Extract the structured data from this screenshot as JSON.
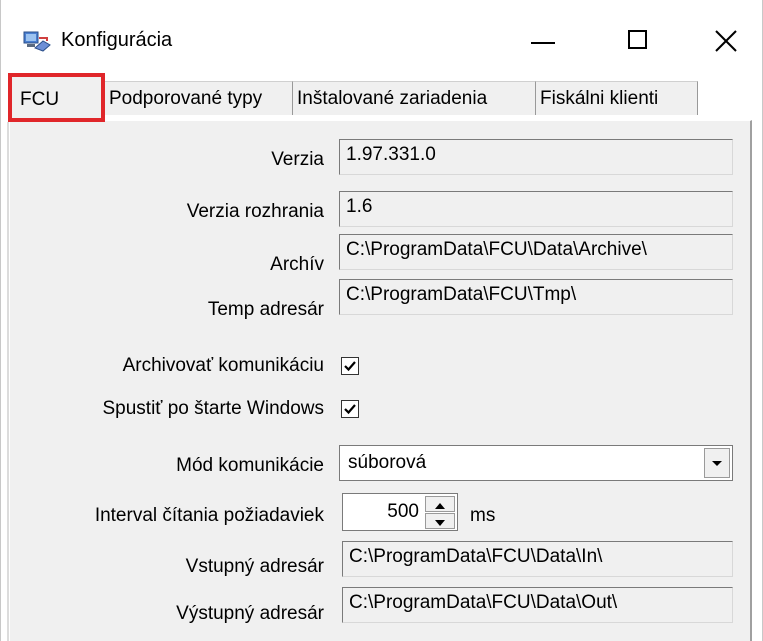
{
  "window": {
    "title": "Konfigurácia",
    "icon": "network-config-icon",
    "controls": [
      "minimize-icon",
      "maximize-icon",
      "close-icon"
    ]
  },
  "tabs": [
    {
      "label": "FCU",
      "active": true,
      "highlighted": true
    },
    {
      "label": "Podporované typy",
      "active": false
    },
    {
      "label": "Inštalované zariadenia",
      "active": false
    },
    {
      "label": "Fiskálni klienti",
      "active": false
    }
  ],
  "highlight_color": "#e0262a",
  "form": {
    "version": {
      "label": "Verzia",
      "value": "1.97.331.0"
    },
    "interface_version": {
      "label": "Verzia rozhrania",
      "value": "1.6"
    },
    "archive": {
      "label": "Archív",
      "value": "C:\\ProgramData\\FCU\\Data\\Archive\\"
    },
    "temp_dir": {
      "label": "Temp adresár",
      "value": "C:\\ProgramData\\FCU\\Tmp\\"
    },
    "archive_communication": {
      "label": "Archivovať komunikáciu",
      "checked": true
    },
    "start_with_windows": {
      "label": "Spustiť po štarte Windows",
      "checked": true
    },
    "communication_mode": {
      "label": "Mód komunikácie",
      "value": "súborová"
    },
    "read_interval": {
      "label": "Interval čítania požiadaviek",
      "value": "500",
      "unit": "ms"
    },
    "input_dir": {
      "label": "Vstupný adresár",
      "value": "C:\\ProgramData\\FCU\\Data\\In\\"
    },
    "output_dir": {
      "label": "Výstupný adresár",
      "value": "C:\\ProgramData\\FCU\\Data\\Out\\"
    }
  }
}
